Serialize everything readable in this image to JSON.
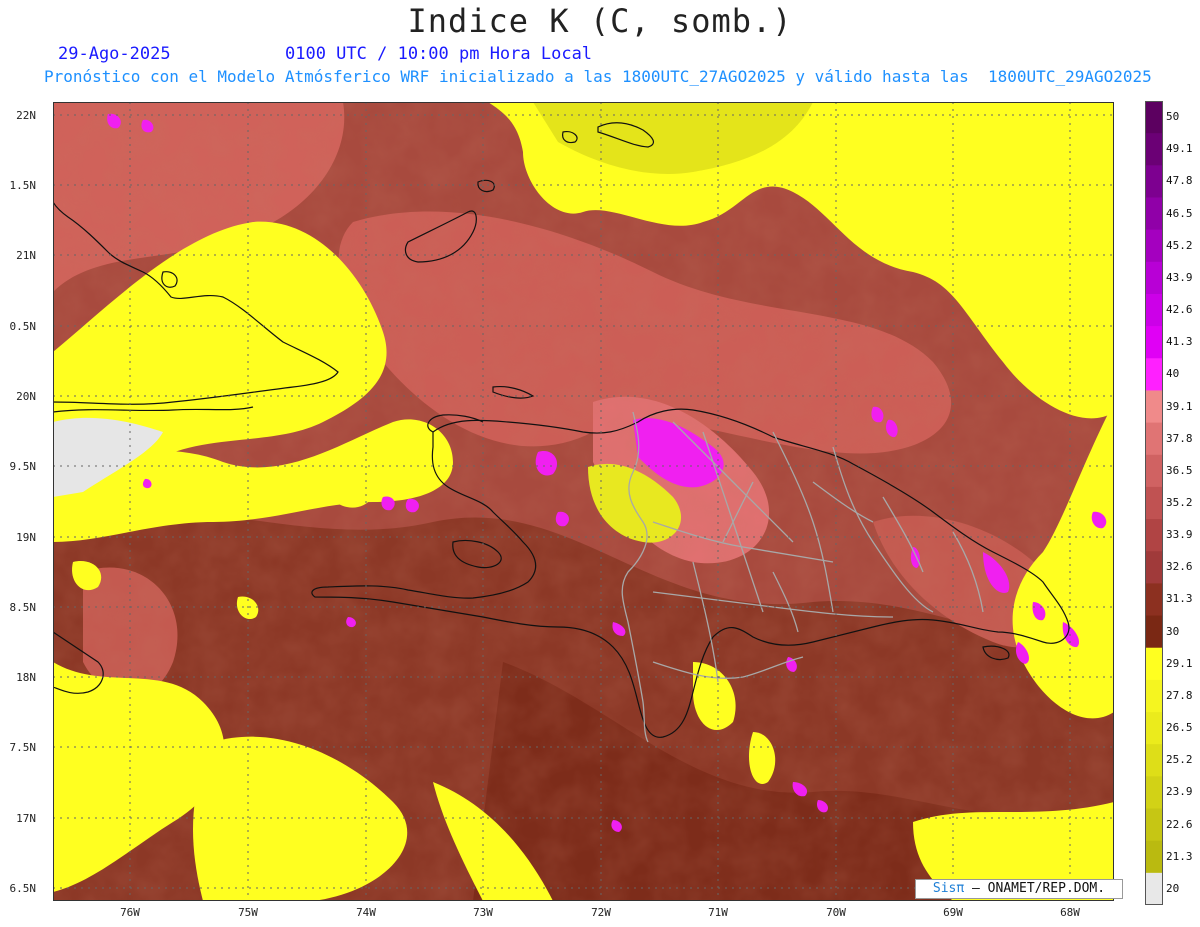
{
  "map": {
    "title": "Indice K (C, somb.)",
    "date": "29-Ago-2025",
    "time_info": "0100 UTC / 10:00 pm Hora Local",
    "forecast_info": "Pronóstico con el Modelo Atmósferico WRF inicializado a las 1800UTC_27AGO2025 y válido hasta las  1800UTC_29AGO2025",
    "credit_brand": "Sisπ",
    "credit_text": " – ONAMET/REP.DOM.",
    "lat_labels": [
      "22N",
      "1.5N",
      "21N",
      "0.5N",
      "20N",
      "9.5N",
      "19N",
      "8.5N",
      "18N",
      "7.5N",
      "17N",
      "6.5N"
    ],
    "lon_labels": [
      "76W",
      "75W",
      "74W",
      "73W",
      "72W",
      "71W",
      "70W",
      "69W",
      "68W"
    ],
    "colorbar": {
      "labels": [
        "50",
        "49.1",
        "47.8",
        "46.5",
        "45.2",
        "43.9",
        "42.6",
        "41.3",
        "40",
        "39.1",
        "37.8",
        "36.5",
        "35.2",
        "33.9",
        "32.6",
        "31.3",
        "30",
        "29.1",
        "27.8",
        "26.5",
        "25.2",
        "23.9",
        "22.6",
        "21.3",
        "20"
      ],
      "colors": [
        "#5c0060",
        "#6b0075",
        "#7d0090",
        "#9000a8",
        "#a400bf",
        "#b800d6",
        "#cc00e8",
        "#e000f5",
        "#ff20ff",
        "#f08a8a",
        "#e07474",
        "#d06262",
        "#c05252",
        "#b04444",
        "#a03a3a",
        "#8c3020",
        "#7a2814",
        "#ffff20",
        "#f5f520",
        "#ebeb1c",
        "#dede18",
        "#d2d216",
        "#c6c614",
        "#baba10",
        "#e8e8e8"
      ]
    },
    "colors": {
      "low": "#ffff20",
      "mid": "#a0463a",
      "high": "#e87070",
      "extreme": "#f020f0",
      "nodata": "#e6e6e6"
    }
  }
}
